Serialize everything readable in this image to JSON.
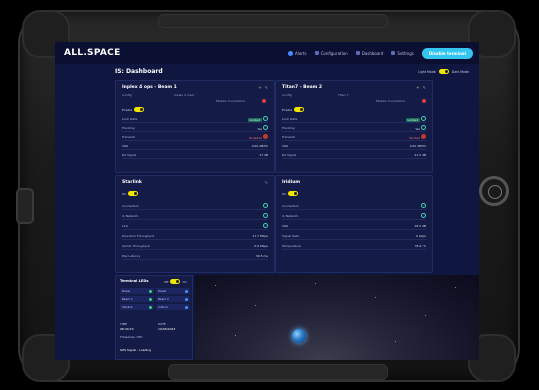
{
  "app": {
    "logo": "ALL.SPACE",
    "page_title": "IS: Dashboard"
  },
  "nav": {
    "alerts": "Alerts",
    "configuration": "Configuration",
    "dashboard": "Dashboard",
    "settings": "Settings",
    "start_button": "Disable terminal"
  },
  "theme": {
    "light": "Light Mode",
    "dark": "Dark Mode"
  },
  "card_beam1": {
    "title": "Inplex 4 ops - Beam 1",
    "col1": "Config",
    "col2": "Inplex 4 main",
    "note": "Modem Connection",
    "rows": [
      {
        "label": "Enable",
        "value": ""
      },
      {
        "label": "Lock state",
        "value": "Locked"
      },
      {
        "label": "Tracking",
        "value": "Yes"
      },
      {
        "label": "Transmit",
        "value": "Disabled"
      },
      {
        "label": "SNR",
        "value": "0.00 dB/Hz"
      },
      {
        "label": "RX Signal",
        "value": "17 dB"
      }
    ]
  },
  "card_beam2": {
    "title": "Titan7 - Beam 2",
    "col1": "Config",
    "col2": "Titan 7",
    "note": "Modem Connection",
    "rows": [
      {
        "label": "Enable",
        "value": ""
      },
      {
        "label": "Lock state",
        "value": "Locked"
      },
      {
        "label": "Tracking",
        "value": "Yes"
      },
      {
        "label": "Transmit",
        "value": "Faulted"
      },
      {
        "label": "SNR",
        "value": "0.00 dB/Hz"
      },
      {
        "label": "RX Signal",
        "value": "21.2 dB"
      }
    ]
  },
  "card_starlink": {
    "title": "Starlink",
    "rows": [
      {
        "label": "Connection",
        "value": ""
      },
      {
        "label": "In Network",
        "value": ""
      },
      {
        "label": "Link",
        "value": ""
      },
      {
        "label": "Downlink Throughput",
        "value": "17.7 Mbps"
      },
      {
        "label": "Uplink Throughput",
        "value": "0.9 Mbps"
      },
      {
        "label": "Pop Latency",
        "value": "39.5 ms"
      }
    ]
  },
  "card_iridium": {
    "title": "Iridium",
    "rows": [
      {
        "label": "Connection",
        "value": ""
      },
      {
        "label": "In Network",
        "value": ""
      },
      {
        "label": "SNR",
        "value": "18.5 dB"
      },
      {
        "label": "Signal Rate",
        "value": "0 kbps"
      },
      {
        "label": "Temperature",
        "value": "35.9 °C"
      }
    ]
  },
  "terminal": {
    "title": "Terminal LEDs",
    "toggle_on": "On",
    "toggle_off": "Off",
    "cells": [
      "Power",
      "Power",
      "Beam 1",
      "Beam 2",
      "Starlink",
      "Iridium"
    ],
    "time_label": "TIME",
    "time_value": "08:30:23",
    "date_label": "DATE",
    "date_value": "10/05/2023",
    "timezone": "Timezone: UTC",
    "gps": "GPS Signal - Loading"
  },
  "colors": {
    "accent": "#33c6f0",
    "toggle": "#f2e600",
    "ok": "#44d3b4",
    "error": "#d93f3f",
    "bg": "#0f1640"
  }
}
